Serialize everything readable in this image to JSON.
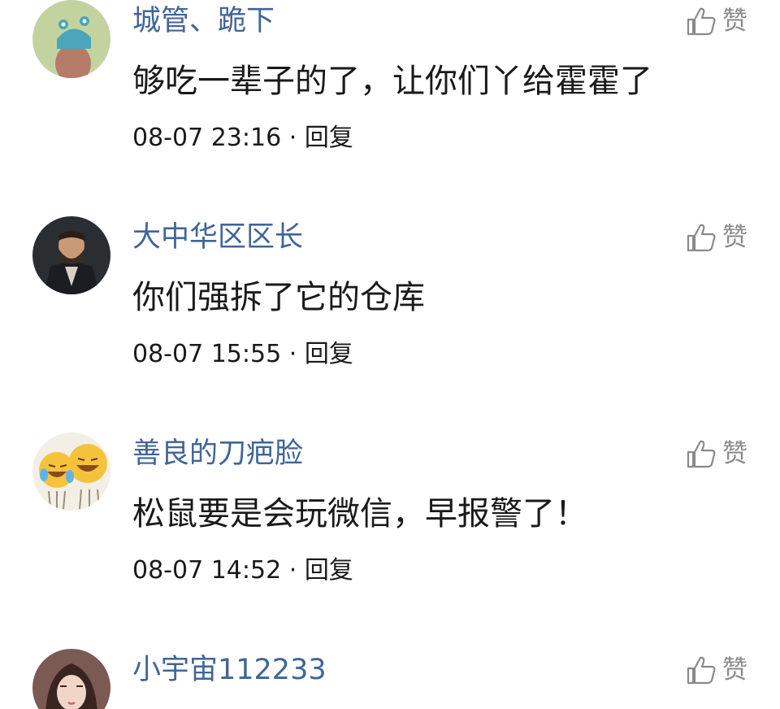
{
  "comments": [
    {
      "username": "城管、跪下",
      "content": "够吃一辈子的了，让你们丫给霍霍了",
      "timestamp": "08-07 23:16",
      "separator": "·",
      "reply_label": "回复",
      "like_label": "赞",
      "like_icon": "thumbs-up-icon"
    },
    {
      "username": "大中华区区长",
      "content": "你们强拆了它的仓库",
      "timestamp": "08-07 15:55",
      "separator": "·",
      "reply_label": "回复",
      "like_label": "赞",
      "like_icon": "thumbs-up-icon"
    },
    {
      "username": "善良的刀疤脸",
      "content": "松鼠要是会玩微信，早报警了！",
      "timestamp": "08-07 14:52",
      "separator": "·",
      "reply_label": "回复",
      "like_label": "赞",
      "like_icon": "thumbs-up-icon"
    },
    {
      "username": "小宇宙112233",
      "like_label": "赞",
      "like_icon": "thumbs-up-icon"
    }
  ],
  "colors": {
    "username": "#406599",
    "content": "#1a1a1a",
    "meta": "#1a1a1a",
    "like": "#8a8a8a"
  }
}
